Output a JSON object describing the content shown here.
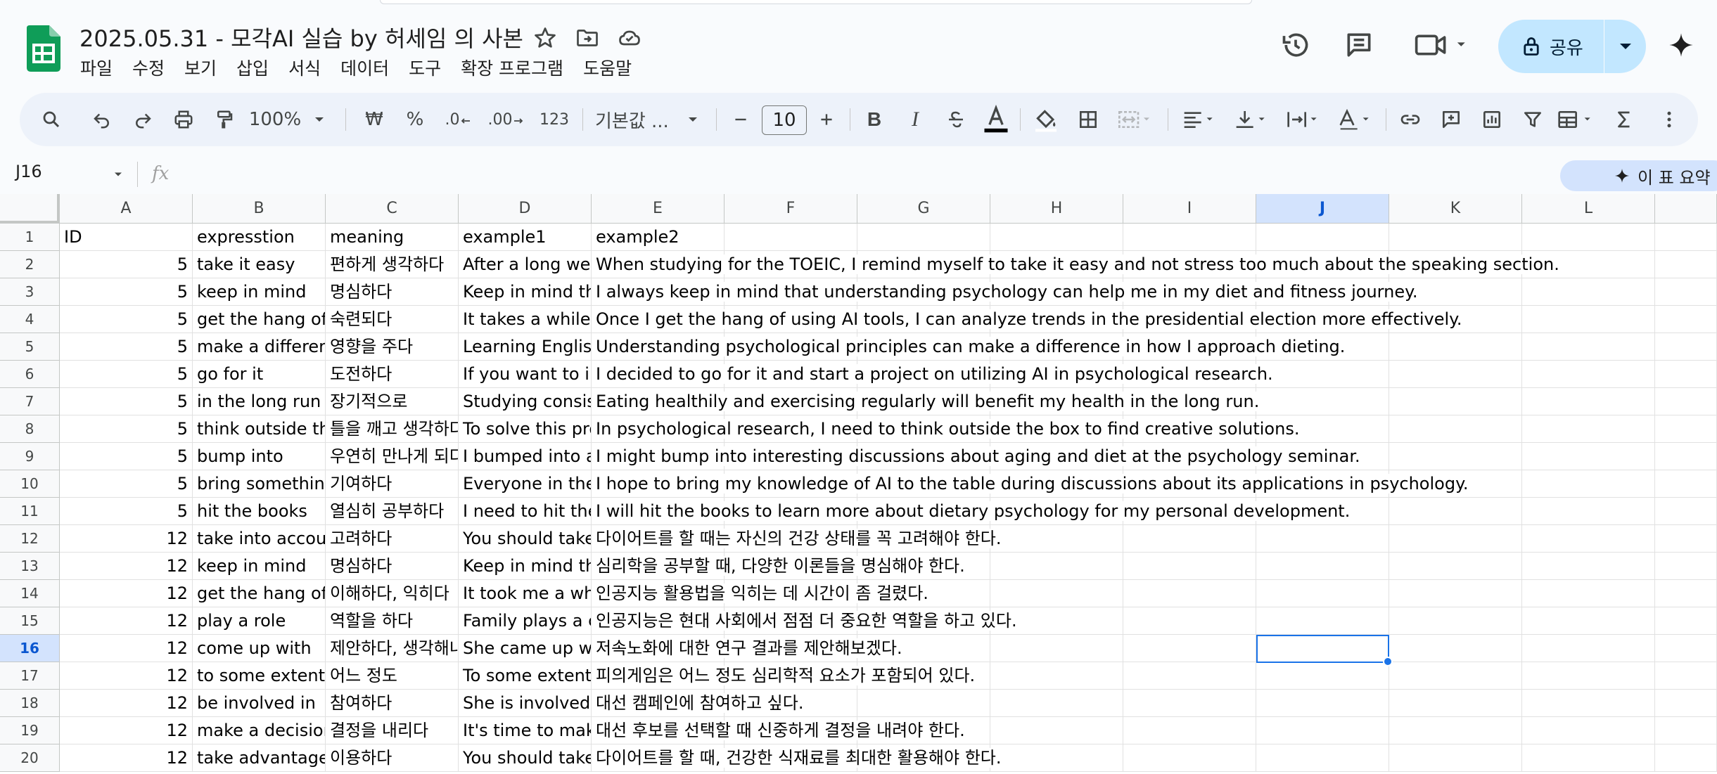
{
  "doc": {
    "title": "2025.05.31 - 모각AI 실습 by 허세임 의 사본"
  },
  "menu": [
    "파일",
    "수정",
    "보기",
    "삽입",
    "서식",
    "데이터",
    "도구",
    "확장 프로그램",
    "도움말"
  ],
  "share": {
    "label": "공유"
  },
  "toolbar": {
    "zoom": "100%",
    "currency": "₩",
    "percent": "%",
    "dec_decrease": ".0",
    "dec_increase": ".00",
    "number_format": "123",
    "font": "기본값 ...",
    "font_size": "10",
    "bold": "B",
    "italic": "I"
  },
  "formula_bar": {
    "name_box": "J16",
    "fx": "fx",
    "summary": "이 표 요약"
  },
  "grid": {
    "columns": [
      "A",
      "B",
      "C",
      "D",
      "E",
      "F",
      "G",
      "H",
      "I",
      "J",
      "K",
      "L"
    ],
    "selected_column": "J",
    "selected_row": "16",
    "rows": [
      {
        "n": "1",
        "a": "ID",
        "b": "expresstion",
        "c": "meaning",
        "d": "example1",
        "e": "example2"
      },
      {
        "n": "2",
        "a": "5",
        "b": "take it easy",
        "c": "편하게 생각하다",
        "d": "After a long wee",
        "e": "When studying for the TOEIC, I remind myself to take it easy and not stress too much about the speaking section."
      },
      {
        "n": "3",
        "a": "5",
        "b": "keep in mind",
        "c": "명심하다",
        "d": "Keep in mind tha",
        "e": "I always keep in mind that understanding psychology can help me in my diet and fitness journey."
      },
      {
        "n": "4",
        "a": "5",
        "b": "get the hang of",
        "c": "숙련되다",
        "d": "It takes a while to",
        "e": "Once I get the hang of using AI tools, I can analyze trends in the presidential election more effectively."
      },
      {
        "n": "5",
        "a": "5",
        "b": "make a differenc",
        "c": "영향을 주다",
        "d": "Learning English",
        "e": "Understanding psychological principles can make a difference in how I approach dieting."
      },
      {
        "n": "6",
        "a": "5",
        "b": "go for it",
        "c": "도전하다",
        "d": "If you want to im",
        "e": "I decided to go for it and start a project on utilizing AI in psychological research."
      },
      {
        "n": "7",
        "a": "5",
        "b": "in the long run",
        "c": "장기적으로",
        "d": "Studying consist",
        "e": "Eating healthily and exercising regularly will benefit my health in the long run."
      },
      {
        "n": "8",
        "a": "5",
        "b": "think outside the",
        "c": "틀을 깨고 생각하다",
        "d": "To solve this pro",
        "e": "In psychological research, I need to think outside the box to find creative solutions."
      },
      {
        "n": "9",
        "a": "5",
        "b": "bump into",
        "c": "우연히 만나게 되다",
        "d": "I bumped into an",
        "e": "I might bump into interesting discussions about aging and diet at the psychology seminar."
      },
      {
        "n": "10",
        "a": "5",
        "b": "bring something",
        "c": "기여하다",
        "d": "Everyone in the t",
        "e": "I hope to bring my knowledge of AI to the table during discussions about its applications in psychology."
      },
      {
        "n": "11",
        "a": "5",
        "b": "hit the books",
        "c": "열심히 공부하다",
        "d": "I need to hit the b",
        "e": "I will hit the books to learn more about dietary psychology for my personal development."
      },
      {
        "n": "12",
        "a": "12",
        "b": "take into accoun",
        "c": "고려하다",
        "d": "You should take",
        "e": "다이어트를 할 때는 자신의 건강 상태를 꼭 고려해야 한다."
      },
      {
        "n": "13",
        "a": "12",
        "b": "keep in mind",
        "c": "명심하다",
        "d": "Keep in mind tha",
        "e": "심리학을 공부할 때, 다양한 이론들을 명심해야 한다."
      },
      {
        "n": "14",
        "a": "12",
        "b": "get the hang of",
        "c": "이해하다, 익히다",
        "d": "It took me a whil",
        "e": "인공지능 활용법을 익히는 데 시간이 좀 걸렸다."
      },
      {
        "n": "15",
        "a": "12",
        "b": "play a role",
        "c": "역할을 하다",
        "d": "Family plays a cr",
        "e": "인공지능은 현대 사회에서 점점 더 중요한 역할을 하고 있다."
      },
      {
        "n": "16",
        "a": "12",
        "b": "come up with",
        "c": "제안하다, 생각해내다",
        "d": "She came up wit",
        "e": "저속노화에 대한 연구 결과를 제안해보겠다."
      },
      {
        "n": "17",
        "a": "12",
        "b": "to some extent",
        "c": "어느 정도",
        "d": "To some extent,",
        "e": "피의게임은 어느 정도 심리학적 요소가 포함되어 있다."
      },
      {
        "n": "18",
        "a": "12",
        "b": "be involved in",
        "c": "참여하다",
        "d": "She is involved i",
        "e": "대선 캠페인에 참여하고 싶다."
      },
      {
        "n": "19",
        "a": "12",
        "b": "make a decision",
        "c": "결정을 내리다",
        "d": "It's time to make",
        "e": "대선 후보를 선택할 때 신중하게 결정을 내려야 한다."
      },
      {
        "n": "20",
        "a": "12",
        "b": "take advantage o",
        "c": "이용하다",
        "d": "You should take",
        "e": "다이어트를 할 때, 건강한 식재료를 최대한 활용해야 한다."
      }
    ]
  },
  "colors": {
    "accent": "#0b57d0",
    "selection": "#1a73e8",
    "share_bg": "#c2e7ff",
    "toolbar_bg": "#edf2fa",
    "sheets_green": "#0f9d58"
  }
}
